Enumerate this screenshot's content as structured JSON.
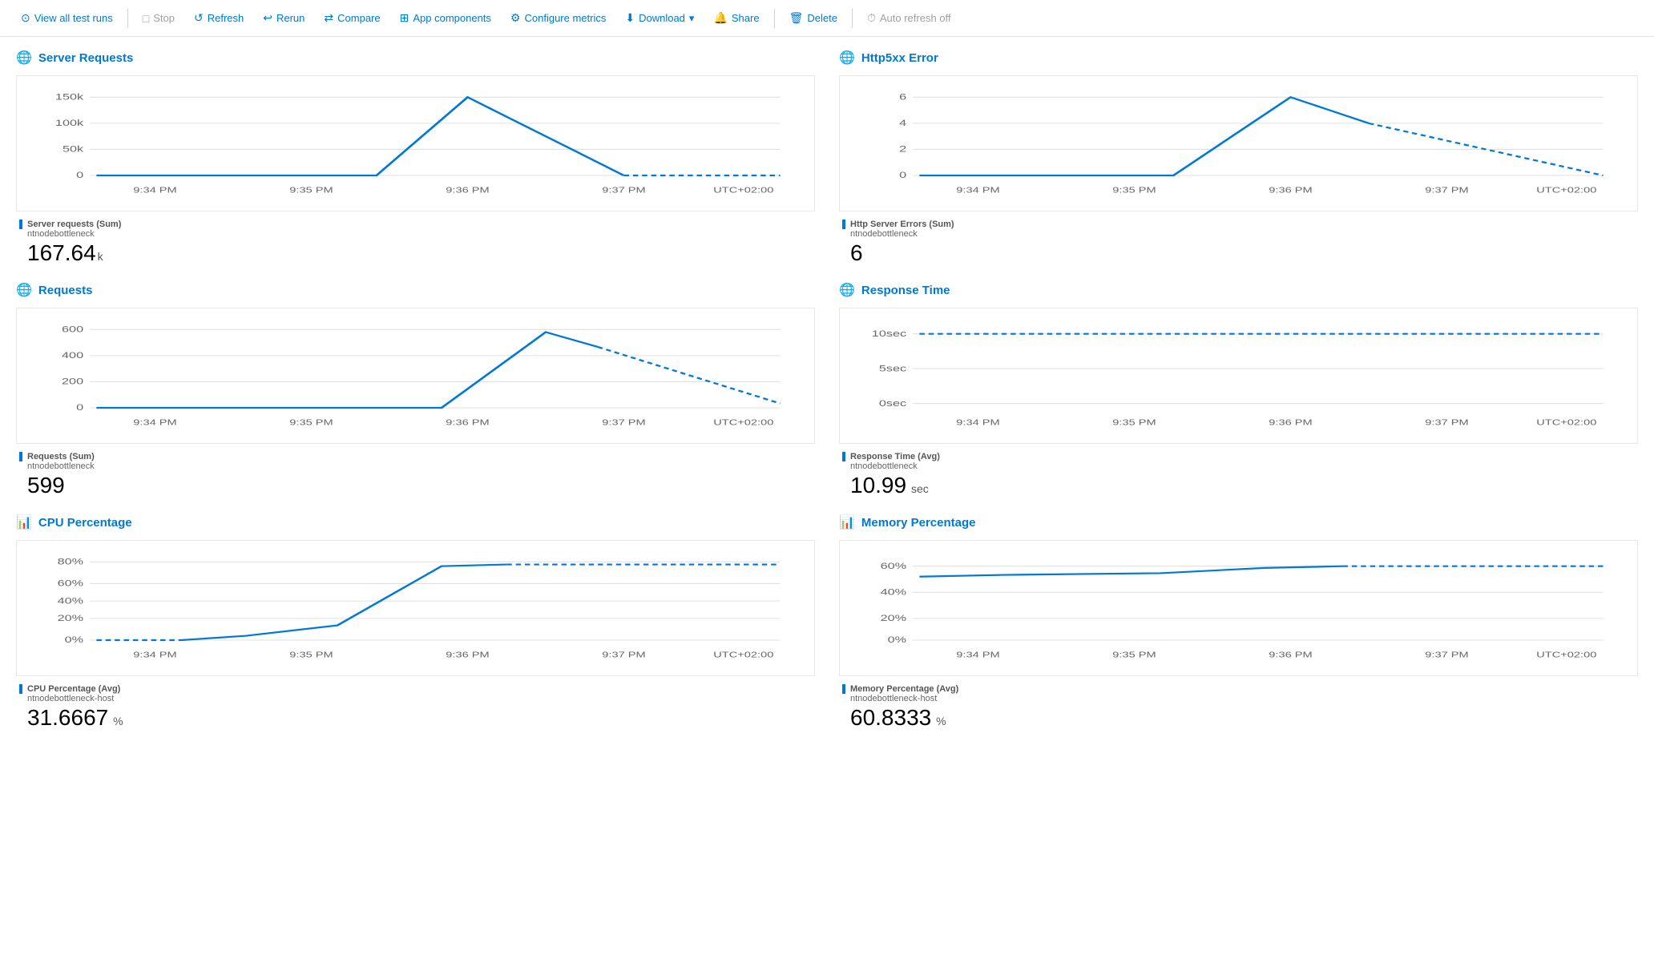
{
  "toolbar": {
    "view_all": "View all test runs",
    "stop": "Stop",
    "refresh": "Refresh",
    "rerun": "Rerun",
    "compare": "Compare",
    "app_components": "App components",
    "configure_metrics": "Configure metrics",
    "download": "Download",
    "share": "Share",
    "delete": "Delete",
    "auto_refresh": "Auto refresh off"
  },
  "charts": {
    "server_requests": {
      "title": "Server Requests",
      "legend_title": "Server requests (Sum)",
      "legend_sub": "ntnodebottleneck",
      "value": "167.64",
      "value_unit": "k",
      "y_labels": [
        "150k",
        "100k",
        "50k",
        "0"
      ],
      "x_labels": [
        "9:34 PM",
        "9:35 PM",
        "9:36 PM",
        "9:37 PM",
        "UTC+02:00"
      ]
    },
    "http5xx": {
      "title": "Http5xx Error",
      "legend_title": "Http Server Errors (Sum)",
      "legend_sub": "ntnodebottleneck",
      "value": "6",
      "value_unit": "",
      "y_labels": [
        "6",
        "4",
        "2",
        "0"
      ],
      "x_labels": [
        "9:34 PM",
        "9:35 PM",
        "9:36 PM",
        "9:37 PM",
        "UTC+02:00"
      ]
    },
    "requests": {
      "title": "Requests",
      "legend_title": "Requests (Sum)",
      "legend_sub": "ntnodebottleneck",
      "value": "599",
      "value_unit": "",
      "y_labels": [
        "600",
        "400",
        "200",
        "0"
      ],
      "x_labels": [
        "9:34 PM",
        "9:35 PM",
        "9:36 PM",
        "9:37 PM",
        "UTC+02:00"
      ]
    },
    "response_time": {
      "title": "Response Time",
      "legend_title": "Response Time (Avg)",
      "legend_sub": "ntnodebottleneck",
      "value": "10.99",
      "value_unit": " sec",
      "y_labels": [
        "10sec",
        "5sec",
        "0sec"
      ],
      "x_labels": [
        "9:34 PM",
        "9:35 PM",
        "9:36 PM",
        "9:37 PM",
        "UTC+02:00"
      ]
    },
    "cpu_percentage": {
      "title": "CPU Percentage",
      "legend_title": "CPU Percentage (Avg)",
      "legend_sub": "ntnodebottleneck-host",
      "value": "31.6667",
      "value_unit": " %",
      "y_labels": [
        "80%",
        "60%",
        "40%",
        "20%",
        "0%"
      ],
      "x_labels": [
        "9:34 PM",
        "9:35 PM",
        "9:36 PM",
        "9:37 PM",
        "UTC+02:00"
      ]
    },
    "memory_percentage": {
      "title": "Memory Percentage",
      "legend_title": "Memory Percentage (Avg)",
      "legend_sub": "ntnodebottleneck-host",
      "value": "60.8333",
      "value_unit": " %",
      "y_labels": [
        "60%",
        "40%",
        "20%",
        "0%"
      ],
      "x_labels": [
        "9:34 PM",
        "9:35 PM",
        "9:36 PM",
        "9:37 PM",
        "UTC+02:00"
      ]
    }
  }
}
